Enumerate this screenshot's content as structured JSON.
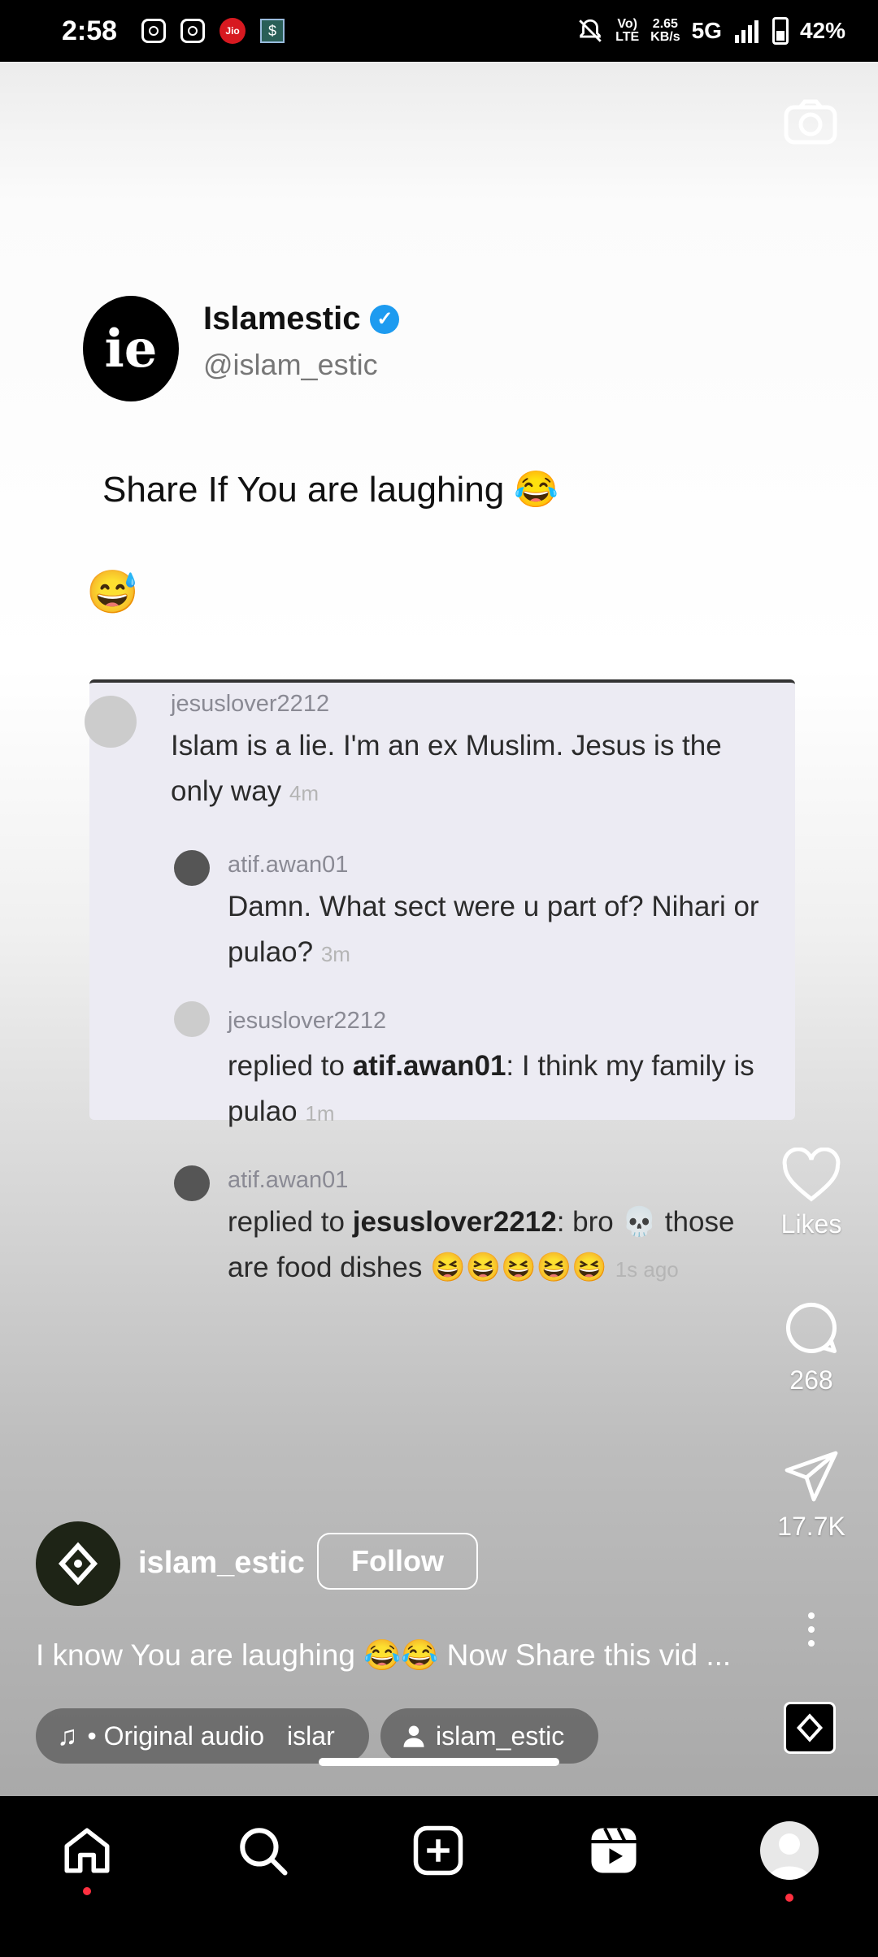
{
  "status_bar": {
    "time": "2:58",
    "net_speed": "2.65",
    "net_unit": "KB/s",
    "volte": "Vo)",
    "lte": "LTE",
    "network": "5G",
    "battery": "42%"
  },
  "post": {
    "author_name": "Islamestic",
    "author_handle": "@islam_estic",
    "avatar_text": "ie",
    "text": "Share If You are laughing",
    "text_emoji": "😂",
    "inner_emoji": "😅",
    "comments": [
      {
        "user": "jesuslover2212",
        "text": "Islam is a lie. I'm an ex Muslim. Jesus is the",
        "text2": "only way",
        "time": "4m"
      },
      {
        "user": "atif.awan01",
        "text": "Damn. What sect were u part of? Nihari or",
        "text2": "pulao?",
        "time": "3m"
      },
      {
        "user": "jesuslover2212",
        "prefix": "replied to ",
        "mention": "atif.awan01",
        "text": ": I think my family is",
        "text2": "pulao",
        "time": "1m"
      },
      {
        "user": "atif.awan01",
        "prefix": "replied to ",
        "mention": "jesuslover2212",
        "text": ": bro 💀 those",
        "text2": "are food dishes 😆😆😆😆😆",
        "time": "1s ago"
      }
    ]
  },
  "actions": {
    "likes_label": "Likes",
    "comments_count": "268",
    "shares_count": "17.7K"
  },
  "reel": {
    "owner": "islam_estic",
    "follow_label": "Follow",
    "caption": "I know You are laughing 😂😂 Now Share this vid ...",
    "audio_label": "• Original audio",
    "audio_scroll": "islar",
    "tagged_user": "islam_estic"
  },
  "colors": {
    "verified": "#1d9bf0",
    "notification_dot": "#ff3040"
  }
}
